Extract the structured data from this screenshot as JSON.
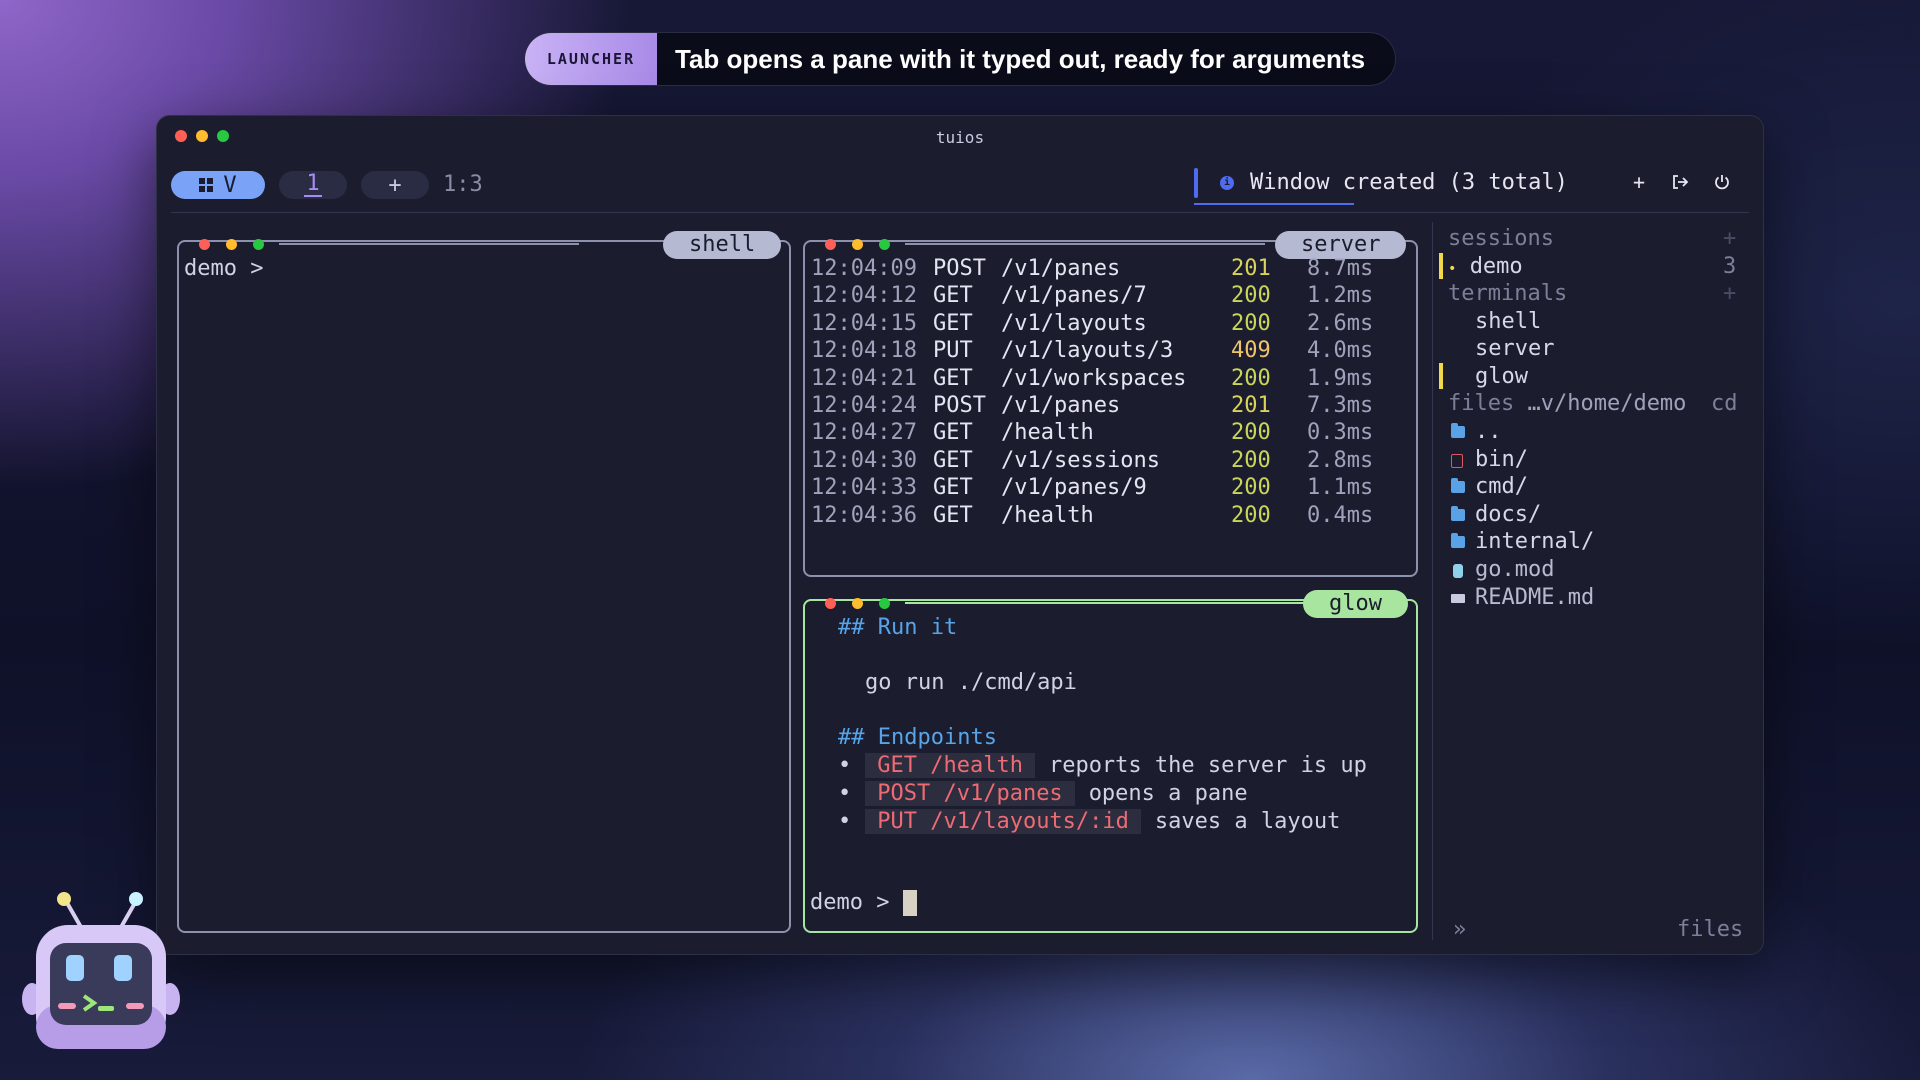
{
  "banner": {
    "tag": "LAUNCHER",
    "text": "Tab opens a pane with it typed out, ready for arguments"
  },
  "window": {
    "title": "tuios"
  },
  "tabbar": {
    "view_label": "V",
    "workspace": "1",
    "add_label": "+",
    "ratio": "1:3",
    "notification": "Window created (3 total)",
    "add_button": "+",
    "detach_icon": "arrow-out-icon",
    "power_icon": "power-icon"
  },
  "panes": {
    "shell": {
      "label": "shell",
      "prompt": "demo >"
    },
    "server": {
      "label": "server",
      "log": [
        {
          "time": "12:04:09",
          "method": "POST",
          "path": "/v1/panes",
          "status": "201",
          "duration": "8.7ms"
        },
        {
          "time": "12:04:12",
          "method": "GET",
          "path": "/v1/panes/7",
          "status": "200",
          "duration": "1.2ms"
        },
        {
          "time": "12:04:15",
          "method": "GET",
          "path": "/v1/layouts",
          "status": "200",
          "duration": "2.6ms"
        },
        {
          "time": "12:04:18",
          "method": "PUT",
          "path": "/v1/layouts/3",
          "status": "409",
          "duration": "4.0ms"
        },
        {
          "time": "12:04:21",
          "method": "GET",
          "path": "/v1/workspaces",
          "status": "200",
          "duration": "1.9ms"
        },
        {
          "time": "12:04:24",
          "method": "POST",
          "path": "/v1/panes",
          "status": "201",
          "duration": "7.3ms"
        },
        {
          "time": "12:04:27",
          "method": "GET",
          "path": "/health",
          "status": "200",
          "duration": "0.3ms"
        },
        {
          "time": "12:04:30",
          "method": "GET",
          "path": "/v1/sessions",
          "status": "200",
          "duration": "2.8ms"
        },
        {
          "time": "12:04:33",
          "method": "GET",
          "path": "/v1/panes/9",
          "status": "200",
          "duration": "1.1ms"
        },
        {
          "time": "12:04:36",
          "method": "GET",
          "path": "/health",
          "status": "200",
          "duration": "0.4ms"
        }
      ]
    },
    "glow": {
      "label": "glow",
      "heading1": "## Run it",
      "command": "go run ./cmd/api",
      "heading2": "## Endpoints",
      "endpoints": [
        {
          "code": "GET /health",
          "desc": "reports the server is up"
        },
        {
          "code": "POST /v1/panes",
          "desc": "opens a pane"
        },
        {
          "code": "PUT /v1/layouts/:id",
          "desc": "saves a layout"
        }
      ],
      "bullet": "•",
      "prompt": "demo >"
    }
  },
  "sidebar": {
    "sessions_label": "sessions",
    "sessions_add": "+",
    "session": {
      "bullet": "•",
      "name": "demo",
      "count": "3"
    },
    "terminals_label": "terminals",
    "terminals_add": "+",
    "terminals": [
      "shell",
      "server",
      "glow"
    ],
    "files_label": "files",
    "files_path": "…v/home/demo",
    "files_cd": "cd",
    "files": [
      {
        "name": "..",
        "icon": "folder-open-icon"
      },
      {
        "name": "bin/",
        "icon": "binary-folder-icon"
      },
      {
        "name": "cmd/",
        "icon": "folder-icon"
      },
      {
        "name": "docs/",
        "icon": "folder-icon"
      },
      {
        "name": "internal/",
        "icon": "folder-icon"
      },
      {
        "name": "go.mod",
        "icon": "go-file-icon"
      },
      {
        "name": "README.md",
        "icon": "markdown-icon"
      }
    ],
    "footer_chevron": "»",
    "footer_label": "files"
  },
  "colors": {
    "status_201": "#d8d35a",
    "status_200": "#c9d65a",
    "status_409": "#f0c46a",
    "accent": "#7aa2f7",
    "active_border": "#a8e6a0"
  }
}
